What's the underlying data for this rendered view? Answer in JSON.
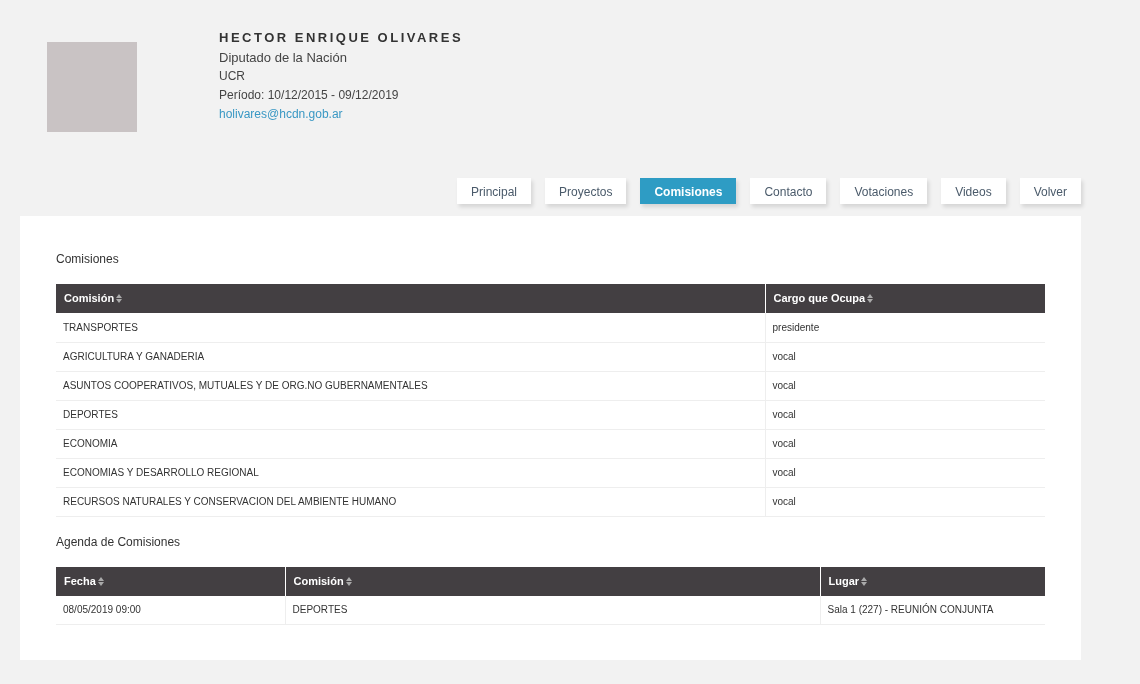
{
  "profile": {
    "name": "HECTOR ENRIQUE OLIVARES",
    "role": "Diputado de la Nación",
    "party": "UCR",
    "period": "Período: 10/12/2015 - 09/12/2019",
    "email": "holivares@hcdn.gob.ar"
  },
  "tabs": [
    {
      "label": "Principal",
      "selected": false
    },
    {
      "label": "Proyectos",
      "selected": false
    },
    {
      "label": "Comisiones",
      "selected": true
    },
    {
      "label": "Contacto",
      "selected": false
    },
    {
      "label": "Votaciones",
      "selected": false
    },
    {
      "label": "Videos",
      "selected": false
    },
    {
      "label": "Volver",
      "selected": false
    }
  ],
  "committees": {
    "title": "Comisiones",
    "columns": [
      "Comisión",
      "Cargo que Ocupa"
    ],
    "rows": [
      [
        "TRANSPORTES",
        "presidente"
      ],
      [
        "AGRICULTURA Y GANADERIA",
        "vocal"
      ],
      [
        "ASUNTOS COOPERATIVOS, MUTUALES Y DE ORG.NO GUBERNAMENTALES",
        "vocal"
      ],
      [
        "DEPORTES",
        "vocal"
      ],
      [
        "ECONOMIA",
        "vocal"
      ],
      [
        "ECONOMIAS Y DESARROLLO REGIONAL",
        "vocal"
      ],
      [
        "RECURSOS NATURALES Y CONSERVACION DEL AMBIENTE HUMANO",
        "vocal"
      ]
    ]
  },
  "agenda": {
    "title": "Agenda de Comisiones",
    "columns": [
      "Fecha",
      "Comisión",
      "Lugar"
    ],
    "rows": [
      [
        "08/05/2019 09:00",
        "DEPORTES",
        "Sala 1 (227) - REUNIÓN CONJUNTA"
      ]
    ]
  }
}
